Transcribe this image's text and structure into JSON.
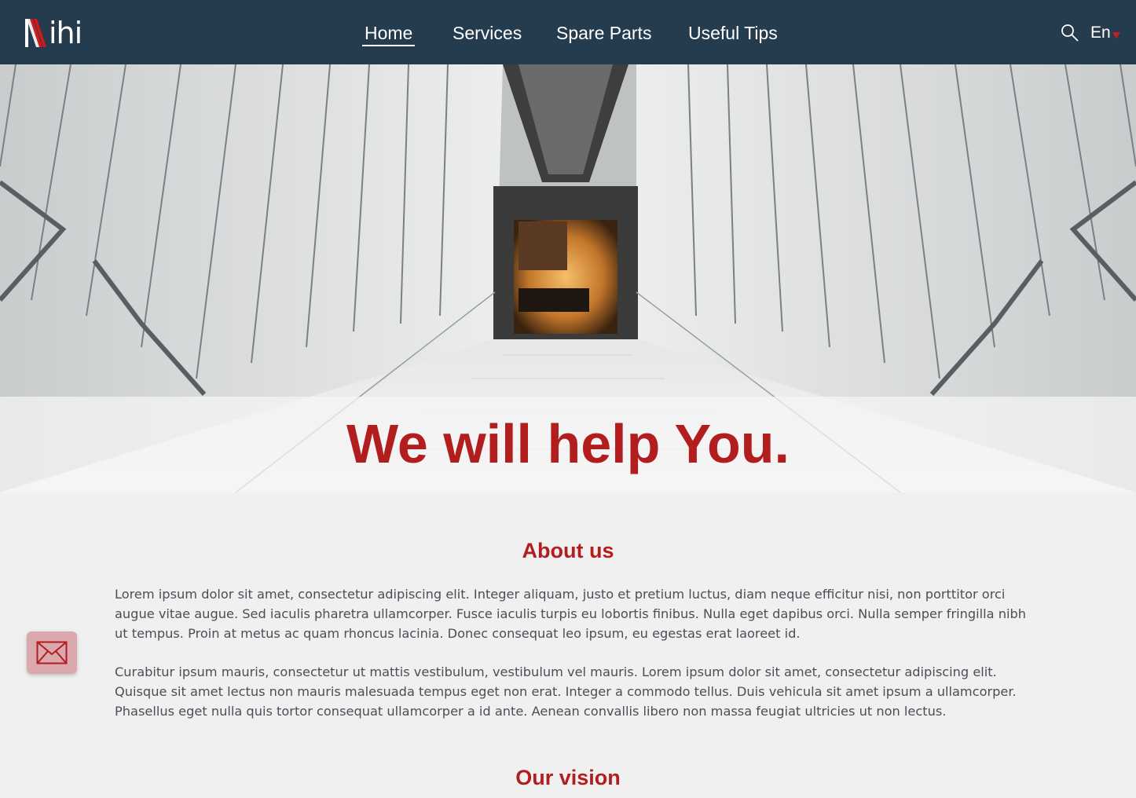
{
  "header": {
    "logo_text": "ihi",
    "nav": [
      {
        "label": "Home"
      },
      {
        "label": "Services"
      },
      {
        "label": "Spare Parts"
      },
      {
        "label": "Useful Tips"
      }
    ],
    "language": "En"
  },
  "hero": {
    "headline": "We will help You."
  },
  "about": {
    "title": "About us",
    "paragraphs": [
      "Lorem ipsum dolor sit amet, consectetur adipiscing elit. Integer aliquam, justo et pretium luctus, diam neque efficitur nisi, non porttitor orci augue vitae augue. Sed iaculis pharetra ullamcorper. Fusce iaculis turpis eu lobortis finibus. Nulla eget dapibus orci. Nulla semper fringilla nibh ut tempus. Proin at metus ac quam rhoncus lacinia. Donec consequat leo ipsum, eu egestas erat laoreet id.",
      "Curabitur ipsum mauris, consectetur ut mattis vestibulum, vestibulum vel mauris. Lorem ipsum dolor sit amet, consectetur adipiscing elit. Quisque sit amet lectus non mauris malesuada tempus eget non erat. Integer a commodo tellus. Duis vehicula sit amet ipsum a ullamcorper. Phasellus eget nulla quis tortor consequat ullamcorper a id ante. Aenean convallis libero non massa feugiat ultricies ut non lectus."
    ]
  },
  "vision": {
    "title": "Our vision"
  },
  "colors": {
    "header_bg": "#253b4e",
    "accent": "#b21d1d",
    "page_bg": "#eff0ef",
    "mail_button_bg": "#dba8ae"
  },
  "icons": {
    "search": "search-icon",
    "mail": "envelope-icon",
    "language_caret": "caret-down-icon"
  }
}
